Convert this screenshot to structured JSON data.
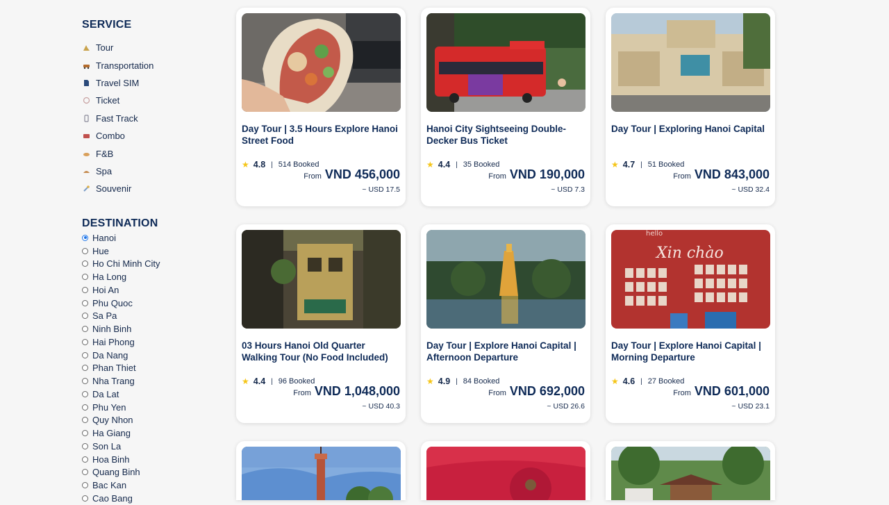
{
  "sidebar": {
    "service_title": "SERVICE",
    "services": [
      {
        "label": "Tour",
        "icon": "tour-icon"
      },
      {
        "label": "Transportation",
        "icon": "car-icon"
      },
      {
        "label": "Travel SIM",
        "icon": "sim-card-icon"
      },
      {
        "label": "Ticket",
        "icon": "ticket-icon"
      },
      {
        "label": "Fast Track",
        "icon": "fast-track-icon"
      },
      {
        "label": "Combo",
        "icon": "combo-icon"
      },
      {
        "label": "F&B",
        "icon": "food-icon"
      },
      {
        "label": "Spa",
        "icon": "spa-icon"
      },
      {
        "label": "Souvenir",
        "icon": "souvenir-icon"
      }
    ],
    "destination_title": "DESTINATION",
    "destinations": [
      {
        "label": "Hanoi",
        "checked": true
      },
      {
        "label": "Hue",
        "checked": false
      },
      {
        "label": "Ho Chi Minh City",
        "checked": false
      },
      {
        "label": "Ha Long",
        "checked": false
      },
      {
        "label": "Hoi An",
        "checked": false
      },
      {
        "label": "Phu Quoc",
        "checked": false
      },
      {
        "label": "Sa Pa",
        "checked": false
      },
      {
        "label": "Ninh Binh",
        "checked": false
      },
      {
        "label": "Hai Phong",
        "checked": false
      },
      {
        "label": "Da Nang",
        "checked": false
      },
      {
        "label": "Phan Thiet",
        "checked": false
      },
      {
        "label": "Nha Trang",
        "checked": false
      },
      {
        "label": "Da Lat",
        "checked": false
      },
      {
        "label": "Phu Yen",
        "checked": false
      },
      {
        "label": "Quy Nhon",
        "checked": false
      },
      {
        "label": "Ha Giang",
        "checked": false
      },
      {
        "label": "Son La",
        "checked": false
      },
      {
        "label": "Hoa Binh",
        "checked": false
      },
      {
        "label": "Quang Binh",
        "checked": false
      },
      {
        "label": "Bac Kan",
        "checked": false
      },
      {
        "label": "Cao Bang",
        "checked": false
      }
    ]
  },
  "colors": {
    "heading": "#0e2a57",
    "star": "#f5c518",
    "radio_selected": "#1a73e8",
    "background": "#f6f6f6"
  },
  "products": [
    {
      "title": "Day Tour | 3.5 Hours Explore Hanoi Street Food",
      "rating": "4.8",
      "booked": "514 Booked",
      "from_label": "From",
      "price": "VND 456,000",
      "usd": "~ USD 17.5",
      "image": "banh-mi-photo"
    },
    {
      "title": "Hanoi City Sightseeing Double-Decker Bus Ticket",
      "rating": "4.4",
      "booked": "35 Booked",
      "from_label": "From",
      "price": "VND 190,000",
      "usd": "~ USD 7.3",
      "image": "red-bus-photo"
    },
    {
      "title": "Day Tour | Exploring Hanoi Capital",
      "rating": "4.7",
      "booked": "51 Booked",
      "from_label": "From",
      "price": "VND 843,000",
      "usd": "~ USD 32.4",
      "image": "trang-tien-plaza-photo"
    },
    {
      "title": "03 Hours Hanoi Old Quarter Walking Tour (No Food Included)",
      "rating": "4.4",
      "booked": "96 Booked",
      "from_label": "From",
      "price": "VND 1,048,000",
      "usd": "~ USD 40.3",
      "image": "old-quarter-photo"
    },
    {
      "title": "Day Tour | Explore Hanoi Capital | Afternoon Departure",
      "rating": "4.9",
      "booked": "84 Booked",
      "from_label": "From",
      "price": "VND 692,000",
      "usd": "~ USD 26.6",
      "image": "turtle-tower-photo"
    },
    {
      "title": "Day Tour | Explore Hanoi Capital | Morning Departure",
      "rating": "4.6",
      "booked": "27 Booked",
      "from_label": "From",
      "price": "VND 601,000",
      "usd": "~ USD 23.1",
      "image": "xin-chao-wall-photo",
      "image_text_1": "Xin chào",
      "image_text_2": "hello"
    }
  ],
  "partial_products": [
    {
      "image": "flag-tower-photo"
    },
    {
      "image": "incense-photo"
    },
    {
      "image": "temple-photo"
    }
  ]
}
